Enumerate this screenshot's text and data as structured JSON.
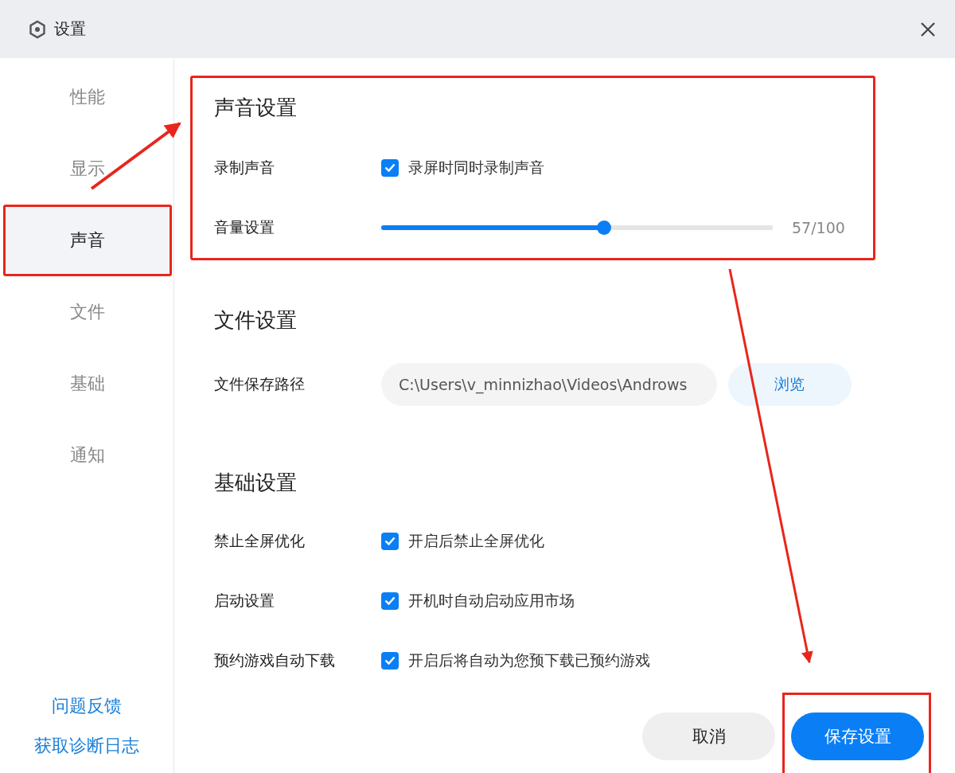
{
  "window": {
    "title": "设置"
  },
  "sidebar": {
    "items": [
      {
        "label": "性能",
        "selected": false,
        "highlighted": false
      },
      {
        "label": "显示",
        "selected": false,
        "highlighted": false
      },
      {
        "label": "声音",
        "selected": true,
        "highlighted": true
      },
      {
        "label": "文件",
        "selected": false,
        "highlighted": false
      },
      {
        "label": "基础",
        "selected": false,
        "highlighted": false
      },
      {
        "label": "通知",
        "selected": false,
        "highlighted": false
      }
    ],
    "links": [
      "问题反馈",
      "获取诊断日志"
    ]
  },
  "sections": [
    {
      "title": "声音设置",
      "highlighted": true,
      "rows": [
        {
          "kind": "checkbox",
          "label": "录制声音",
          "text": "录屏时同时录制声音",
          "checked": true
        },
        {
          "kind": "slider",
          "label": "音量设置",
          "level": 0.57,
          "reading": "57/100"
        }
      ]
    },
    {
      "title": "文件设置",
      "highlighted": false,
      "rows": [
        {
          "kind": "path",
          "label": "文件保存路径",
          "value": "C:\\Users\\v_minnizhao\\Videos\\Androws",
          "button": "浏览"
        }
      ]
    },
    {
      "title": "基础设置",
      "highlighted": false,
      "rows": [
        {
          "kind": "checkbox",
          "label": "禁止全屏优化",
          "text": "开启后禁止全屏优化",
          "checked": true
        },
        {
          "kind": "checkbox",
          "label": "启动设置",
          "text": "开机时自动启动应用市场",
          "checked": true
        },
        {
          "kind": "checkbox",
          "label": "预约游戏自动下载",
          "text": "开启后将自动为您预下载已预约游戏",
          "checked": true
        }
      ]
    }
  ],
  "buttons": [
    {
      "label": "取消",
      "kind": "secondary",
      "highlighted": false
    },
    {
      "label": "保存设置",
      "kind": "primary",
      "highlighted": true
    }
  ]
}
